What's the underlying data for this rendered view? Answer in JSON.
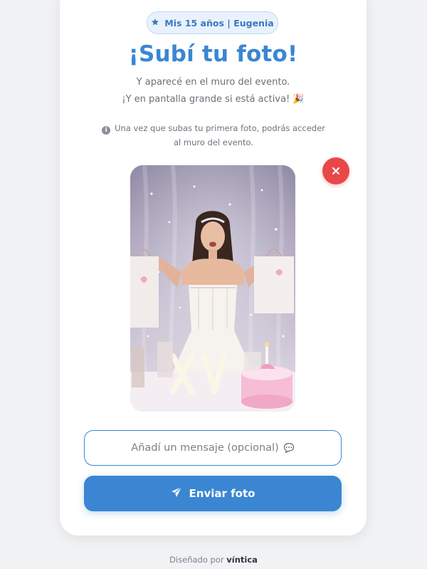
{
  "badge": {
    "icon": "star-icon",
    "label": "Mis 15 años | Eugenia"
  },
  "header": {
    "title": "¡Subí tu foto!",
    "subtitle_line1": "Y aparecé en el muro del evento.",
    "subtitle_line2": "¡Y en pantalla grande si está activa!",
    "subtitle_emoji": "🎉"
  },
  "info_note": {
    "icon": "info-icon",
    "line1": "Una vez que subas tu primera foto, podrás acceder",
    "line2": "al muro del evento."
  },
  "photo_preview": {
    "remove_icon": "close-icon"
  },
  "message_input": {
    "placeholder": "Añadí un mensaje (opcional)",
    "emoji": "💬"
  },
  "send_button": {
    "icon": "send-icon",
    "label": "Enviar foto"
  },
  "footer": {
    "prefix": "Diseñado por",
    "brand": "víntica"
  },
  "colors": {
    "accent": "#3a86d2",
    "danger": "#e94848",
    "background": "#f1f2f4"
  }
}
